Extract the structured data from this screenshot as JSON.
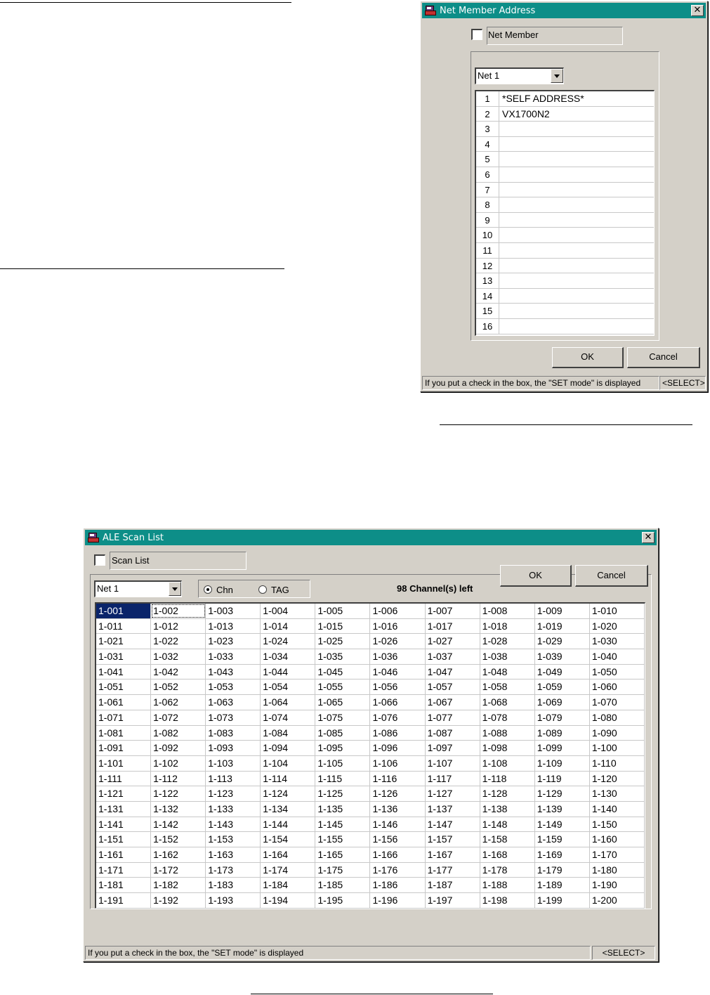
{
  "net_member_dialog": {
    "title": "Net Member Address",
    "close_glyph": "✕",
    "checkbox_label": "Net Member",
    "net_select": "Net  1",
    "rows": [
      {
        "idx": "1",
        "val": "*SELF ADDRESS*"
      },
      {
        "idx": "2",
        "val": "VX1700N2"
      },
      {
        "idx": "3",
        "val": ""
      },
      {
        "idx": "4",
        "val": ""
      },
      {
        "idx": "5",
        "val": ""
      },
      {
        "idx": "6",
        "val": ""
      },
      {
        "idx": "7",
        "val": ""
      },
      {
        "idx": "8",
        "val": ""
      },
      {
        "idx": "9",
        "val": ""
      },
      {
        "idx": "10",
        "val": ""
      },
      {
        "idx": "11",
        "val": ""
      },
      {
        "idx": "12",
        "val": ""
      },
      {
        "idx": "13",
        "val": ""
      },
      {
        "idx": "14",
        "val": ""
      },
      {
        "idx": "15",
        "val": ""
      },
      {
        "idx": "16",
        "val": ""
      }
    ],
    "ok_label": "OK",
    "cancel_label": "Cancel",
    "status_text": "If you put a check in the box, the \"SET mode\" is displayed",
    "status_mode": "<SELECT>"
  },
  "scan_list_dialog": {
    "title": "ALE Scan List",
    "close_glyph": "✕",
    "checkbox_label": "Scan List",
    "net_select": "Net  1",
    "radio_chn": "Chn",
    "radio_tag": "TAG",
    "selected_radio": "Chn",
    "channels_left": "98 Channel(s) left",
    "grid": [
      [
        "1-001",
        "1-002",
        "1-003",
        "1-004",
        "1-005",
        "1-006",
        "1-007",
        "1-008",
        "1-009",
        "1-010"
      ],
      [
        "1-011",
        "1-012",
        "1-013",
        "1-014",
        "1-015",
        "1-016",
        "1-017",
        "1-018",
        "1-019",
        "1-020"
      ],
      [
        "1-021",
        "1-022",
        "1-023",
        "1-024",
        "1-025",
        "1-026",
        "1-027",
        "1-028",
        "1-029",
        "1-030"
      ],
      [
        "1-031",
        "1-032",
        "1-033",
        "1-034",
        "1-035",
        "1-036",
        "1-037",
        "1-038",
        "1-039",
        "1-040"
      ],
      [
        "1-041",
        "1-042",
        "1-043",
        "1-044",
        "1-045",
        "1-046",
        "1-047",
        "1-048",
        "1-049",
        "1-050"
      ],
      [
        "1-051",
        "1-052",
        "1-053",
        "1-054",
        "1-055",
        "1-056",
        "1-057",
        "1-058",
        "1-059",
        "1-060"
      ],
      [
        "1-061",
        "1-062",
        "1-063",
        "1-064",
        "1-065",
        "1-066",
        "1-067",
        "1-068",
        "1-069",
        "1-070"
      ],
      [
        "1-071",
        "1-072",
        "1-073",
        "1-074",
        "1-075",
        "1-076",
        "1-077",
        "1-078",
        "1-079",
        "1-080"
      ],
      [
        "1-081",
        "1-082",
        "1-083",
        "1-084",
        "1-085",
        "1-086",
        "1-087",
        "1-088",
        "1-089",
        "1-090"
      ],
      [
        "1-091",
        "1-092",
        "1-093",
        "1-094",
        "1-095",
        "1-096",
        "1-097",
        "1-098",
        "1-099",
        "1-100"
      ],
      [
        "1-101",
        "1-102",
        "1-103",
        "1-104",
        "1-105",
        "1-106",
        "1-107",
        "1-108",
        "1-109",
        "1-110"
      ],
      [
        "1-111",
        "1-112",
        "1-113",
        "1-114",
        "1-115",
        "1-116",
        "1-117",
        "1-118",
        "1-119",
        "1-120"
      ],
      [
        "1-121",
        "1-122",
        "1-123",
        "1-124",
        "1-125",
        "1-126",
        "1-127",
        "1-128",
        "1-129",
        "1-130"
      ],
      [
        "1-131",
        "1-132",
        "1-133",
        "1-134",
        "1-135",
        "1-136",
        "1-137",
        "1-138",
        "1-139",
        "1-140"
      ],
      [
        "1-141",
        "1-142",
        "1-143",
        "1-144",
        "1-145",
        "1-146",
        "1-147",
        "1-148",
        "1-149",
        "1-150"
      ],
      [
        "1-151",
        "1-152",
        "1-153",
        "1-154",
        "1-155",
        "1-156",
        "1-157",
        "1-158",
        "1-159",
        "1-160"
      ],
      [
        "1-161",
        "1-162",
        "1-163",
        "1-164",
        "1-165",
        "1-166",
        "1-167",
        "1-168",
        "1-169",
        "1-170"
      ],
      [
        "1-171",
        "1-172",
        "1-173",
        "1-174",
        "1-175",
        "1-176",
        "1-177",
        "1-178",
        "1-179",
        "1-180"
      ],
      [
        "1-181",
        "1-182",
        "1-183",
        "1-184",
        "1-185",
        "1-186",
        "1-187",
        "1-188",
        "1-189",
        "1-190"
      ],
      [
        "1-191",
        "1-192",
        "1-193",
        "1-194",
        "1-195",
        "1-196",
        "1-197",
        "1-198",
        "1-199",
        "1-200"
      ]
    ],
    "selected_cell": "1-001",
    "ok_label": "OK",
    "cancel_label": "Cancel",
    "status_text": "If you put a check in the box, the \"SET mode\" is displayed",
    "status_mode": "<SELECT>"
  },
  "colors": {
    "title_bar": "#0d8e88",
    "dialog_face": "#d4d0c8",
    "selection": "#0a246a"
  }
}
